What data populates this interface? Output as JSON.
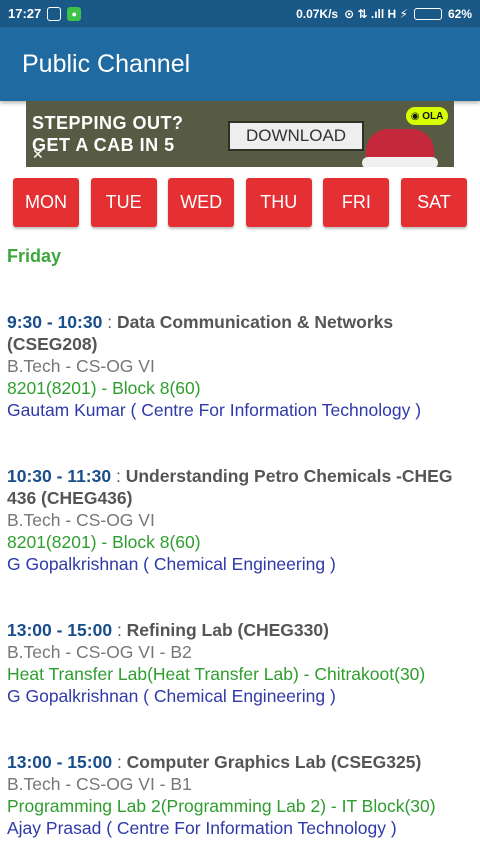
{
  "status_bar": {
    "time": "17:27",
    "network_speed": "0.07K/s",
    "carrier_icons": "⊙ ⇅ .ıll H ⚡",
    "battery_percent": "62%",
    "battery_level": 0.62
  },
  "app_bar": {
    "title": "Public Channel"
  },
  "ad": {
    "line1": "STEPPING OUT?",
    "line2": "GET A CAB IN 5",
    "button": "DOWNLOAD",
    "logo": "◉ OLA",
    "close": "✕"
  },
  "days": [
    "MON",
    "TUE",
    "WED",
    "THU",
    "FRI",
    "SAT"
  ],
  "selected_day": "Friday",
  "schedule": [
    {
      "time": "9:30 - 10:30",
      "title": "Data Communication & Networks (CSEG208)",
      "program": "B.Tech - CS-OG VI",
      "room": "8201(8201) - Block 8(60)",
      "teacher": "Gautam Kumar ( Centre For Information Technology )"
    },
    {
      "time": "10:30 - 11:30",
      "title": "Understanding Petro Chemicals -CHEG 436 (CHEG436)",
      "program": "B.Tech - CS-OG VI",
      "room": "8201(8201) - Block 8(60)",
      "teacher": "G Gopalkrishnan ( Chemical Engineering )"
    },
    {
      "time": "13:00 - 15:00",
      "title": "Refining Lab (CHEG330)",
      "program": "B.Tech - CS-OG VI - B2",
      "room": "Heat Transfer Lab(Heat Transfer Lab) - Chitrakoot(30)",
      "teacher": "G Gopalkrishnan ( Chemical Engineering )"
    },
    {
      "time": "13:00 - 15:00",
      "title": "Computer Graphics Lab (CSEG325)",
      "program": "B.Tech - CS-OG VI - B1",
      "room": "Programming Lab 2(Programming Lab 2) - IT Block(30)",
      "teacher": "Ajay Prasad ( Centre For Information Technology )"
    }
  ]
}
